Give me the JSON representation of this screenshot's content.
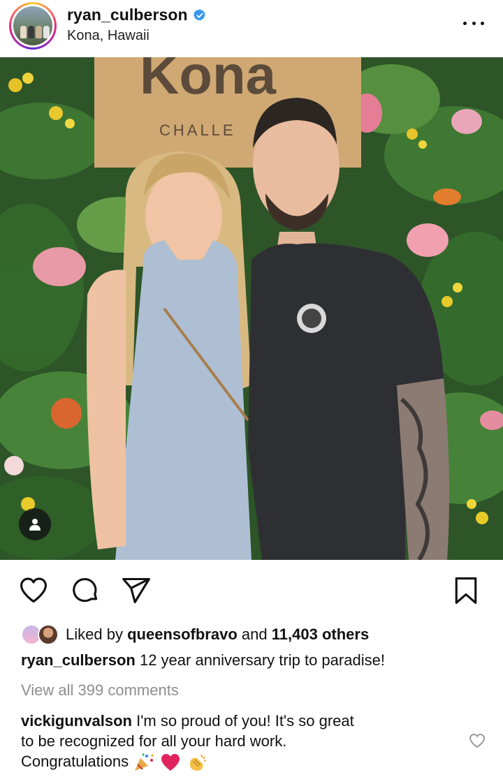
{
  "post_header": {
    "username": "ryan_culberson",
    "location": "Kona, Hawaii"
  },
  "photo": {
    "sign_text": "Kona",
    "sign_subtext": "CHALLE"
  },
  "likes": {
    "prefix": "Liked by",
    "top_liker": "queensofbravo",
    "connector": "and",
    "others": "11,403 others"
  },
  "caption": {
    "username": "ryan_culberson",
    "text": "12 year anniversary trip to paradise!"
  },
  "view_all_comments": "View all 399 comments",
  "comment": {
    "username": "vickigunvalson",
    "line1": "I'm so proud of you!  It's so great",
    "line2": "to be recognized for all your hard work.",
    "line3": "Congratulations"
  },
  "colors": {
    "verified": "#3897f0",
    "heart_red": "#e0245e",
    "muted_text": "#8e8e8e"
  },
  "icons": [
    "verified-badge-icon",
    "more-options-icon",
    "user-tag-icon",
    "like-heart-icon",
    "comment-icon",
    "share-icon",
    "bookmark-icon",
    "comment-like-heart-icon"
  ]
}
